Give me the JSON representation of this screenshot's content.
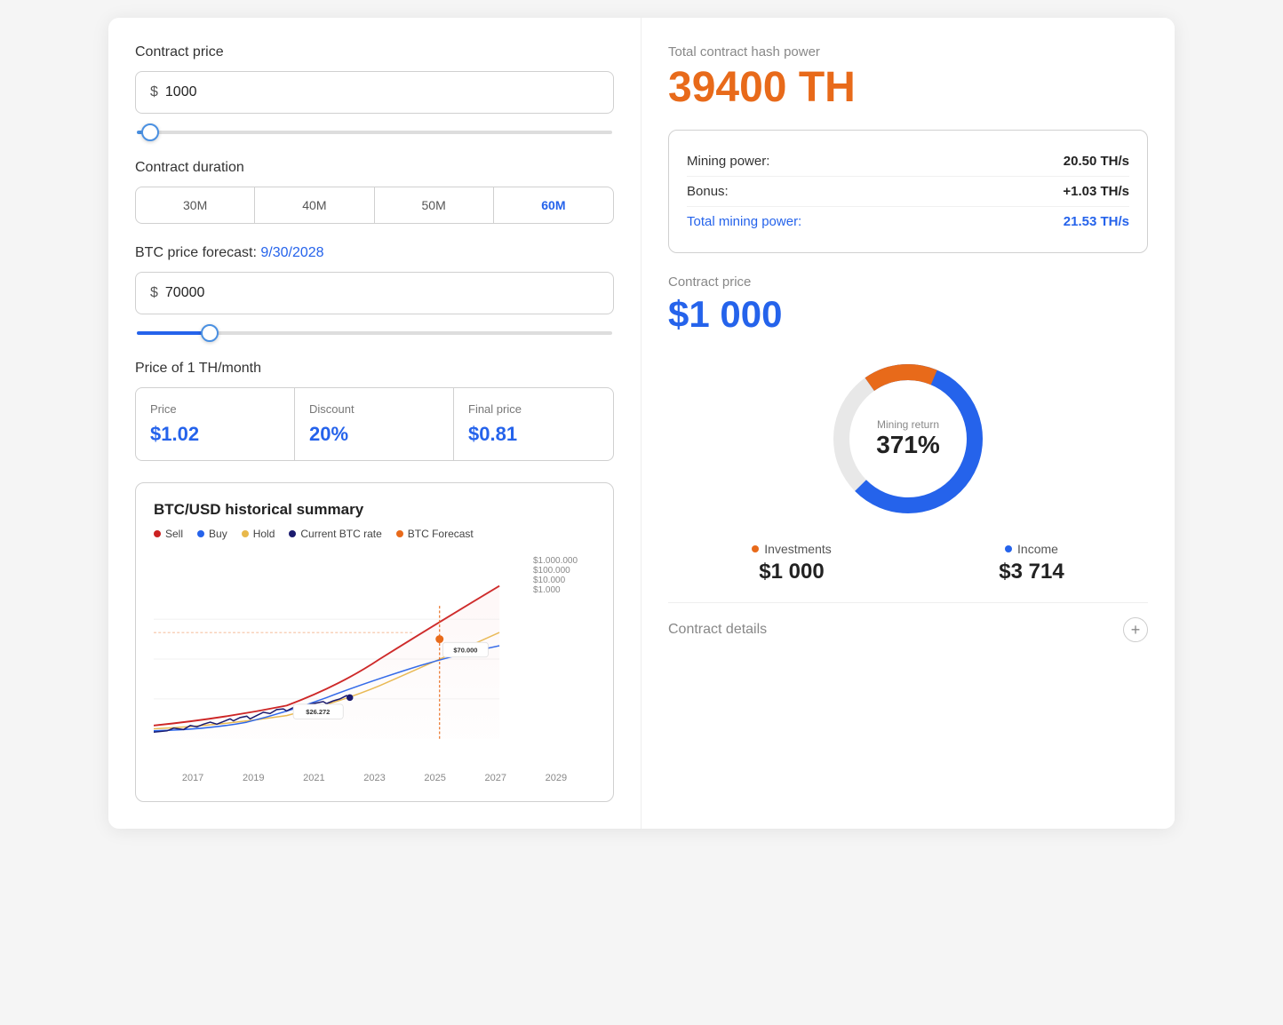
{
  "left": {
    "contract_price_label": "Contract price",
    "contract_price_value": "1000",
    "contract_price_symbol": "$",
    "contract_duration_label": "Contract duration",
    "duration_tabs": [
      {
        "label": "30M",
        "active": false
      },
      {
        "label": "40M",
        "active": false
      },
      {
        "label": "50M",
        "active": false
      },
      {
        "label": "60M",
        "active": true
      }
    ],
    "btc_forecast_label": "BTC price forecast:",
    "btc_forecast_date": "9/30/2028",
    "btc_price_value": "70000",
    "btc_price_symbol": "$",
    "price_th_label": "Price of 1 TH/month",
    "price_cards": [
      {
        "label": "Price",
        "value": "$1.02"
      },
      {
        "label": "Discount",
        "value": "20%"
      },
      {
        "label": "Final price",
        "value": "$0.81"
      }
    ],
    "chart": {
      "title": "BTC/USD historical summary",
      "legend": [
        {
          "label": "Sell",
          "color": "#cc2222"
        },
        {
          "label": "Buy",
          "color": "#2563eb"
        },
        {
          "label": "Hold",
          "color": "#e8b84b"
        },
        {
          "label": "Current BTC rate",
          "color": "#1a1a6e"
        },
        {
          "label": "BTC Forecast",
          "color": "#e86a1a"
        }
      ],
      "y_labels": [
        "$1.000.000",
        "$100.000",
        "$10.000",
        "$1.000"
      ],
      "x_labels": [
        "2017",
        "2019",
        "2021",
        "2023",
        "2025",
        "2027",
        "2029"
      ],
      "tooltip_current": "$26.272",
      "tooltip_forecast": "$70.000"
    }
  },
  "right": {
    "hash_power_label": "Total contract hash power",
    "hash_power_value": "39400 TH",
    "mining_power_label": "Mining power:",
    "mining_power_value": "20.50 TH/s",
    "bonus_label": "Bonus:",
    "bonus_value": "+1.03 TH/s",
    "total_mining_label": "Total mining power:",
    "total_mining_value": "21.53 TH/s",
    "contract_price_label": "Contract price",
    "contract_price_value": "$1 000",
    "donut": {
      "center_label": "Mining return",
      "center_value": "371%",
      "investments_label": "Investments",
      "investments_value": "$1 000",
      "income_label": "Income",
      "income_value": "$3 714",
      "invest_color": "#e86a1a",
      "income_color": "#2563eb"
    },
    "contract_details_label": "Contract details"
  }
}
